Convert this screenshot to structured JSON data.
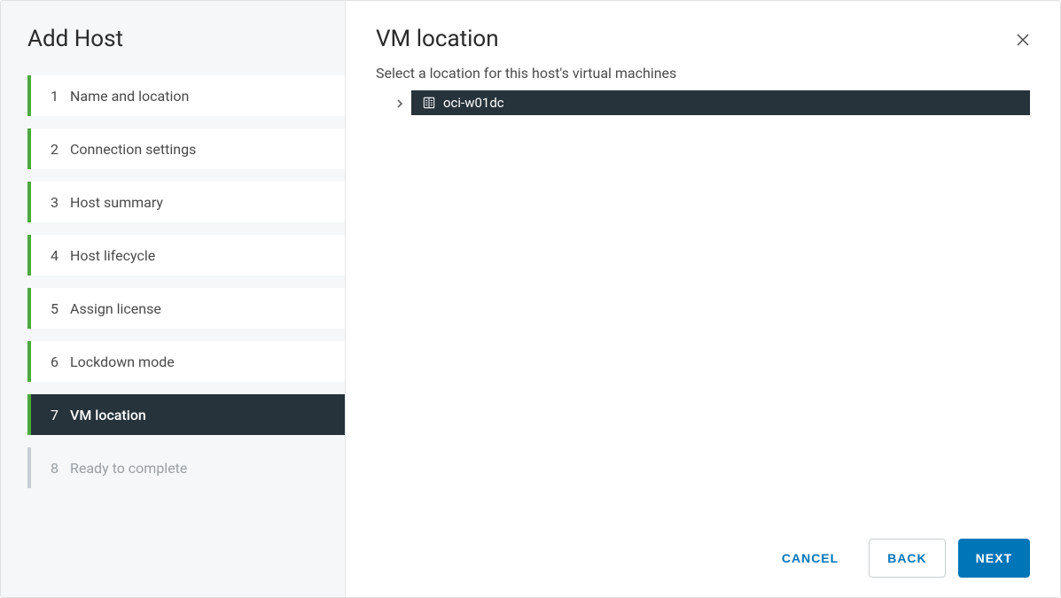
{
  "sidebar": {
    "title": "Add Host",
    "steps": [
      {
        "num": "1",
        "label": "Name and location",
        "state": "completed"
      },
      {
        "num": "2",
        "label": "Connection settings",
        "state": "completed"
      },
      {
        "num": "3",
        "label": "Host summary",
        "state": "completed"
      },
      {
        "num": "4",
        "label": "Host lifecycle",
        "state": "completed"
      },
      {
        "num": "5",
        "label": "Assign license",
        "state": "completed"
      },
      {
        "num": "6",
        "label": "Lockdown mode",
        "state": "completed"
      },
      {
        "num": "7",
        "label": "VM location",
        "state": "active"
      },
      {
        "num": "8",
        "label": "Ready to complete",
        "state": "disabled"
      }
    ]
  },
  "main": {
    "title": "VM location",
    "subtitle": "Select a location for this host's virtual machines",
    "tree": {
      "selected": {
        "icon": "datacenter-icon",
        "label": "oci-w01dc"
      }
    }
  },
  "footer": {
    "cancel": "CANCEL",
    "back": "BACK",
    "next": "NEXT"
  }
}
